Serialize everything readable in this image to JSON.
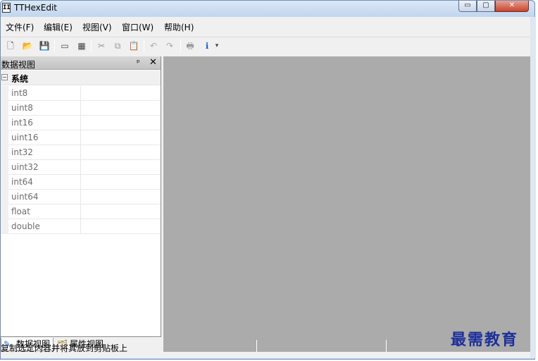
{
  "window": {
    "title": "TTHexEdit",
    "app_icon_glyph": "II",
    "minimize_glyph": "▭",
    "maximize_glyph": "▢",
    "close_glyph": "✕"
  },
  "menu": {
    "items": [
      {
        "label": "文件(F)"
      },
      {
        "label": "编辑(E)"
      },
      {
        "label": "视图(V)"
      },
      {
        "label": "窗口(W)"
      },
      {
        "label": "帮助(H)"
      }
    ]
  },
  "toolbar": {
    "buttons": [
      {
        "icon": "new-file-icon",
        "glyph": "🗋"
      },
      {
        "icon": "open-folder-icon",
        "glyph": "📂"
      },
      {
        "icon": "save-icon",
        "glyph": "💾"
      },
      {
        "icon": "disk-icon",
        "glyph": "▭"
      },
      {
        "icon": "memory-icon",
        "glyph": "▦"
      },
      {
        "icon": "cut-icon",
        "glyph": "✂"
      },
      {
        "icon": "copy-icon",
        "glyph": "⧉"
      },
      {
        "icon": "paste-icon",
        "glyph": "📋"
      },
      {
        "icon": "undo-icon",
        "glyph": "↶"
      },
      {
        "icon": "redo-icon",
        "glyph": "↷"
      },
      {
        "icon": "print-icon",
        "glyph": "🖶"
      },
      {
        "icon": "about-icon",
        "glyph": "ℹ"
      }
    ],
    "dropdown_glyph": "▾"
  },
  "dock": {
    "title": "数据视图",
    "pin_glyph": "ᵖ",
    "close_glyph": "✕",
    "group_label": "系统",
    "expander_glyph": "−",
    "rows": [
      {
        "name": "int8",
        "value": ""
      },
      {
        "name": "uint8",
        "value": ""
      },
      {
        "name": "int16",
        "value": ""
      },
      {
        "name": "uint16",
        "value": ""
      },
      {
        "name": "int32",
        "value": ""
      },
      {
        "name": "uint32",
        "value": ""
      },
      {
        "name": "int64",
        "value": ""
      },
      {
        "name": "uint64",
        "value": ""
      },
      {
        "name": "float",
        "value": ""
      },
      {
        "name": "double",
        "value": ""
      }
    ],
    "tabs": [
      {
        "label": "数据视图",
        "icon": "data-view-icon",
        "glyph": "✎"
      },
      {
        "label": "属性视图",
        "icon": "property-view-icon",
        "glyph": "🗂"
      }
    ]
  },
  "status": {
    "text": "复制选定内容并将其放到剪贴板上"
  },
  "watermark": "最需教育"
}
